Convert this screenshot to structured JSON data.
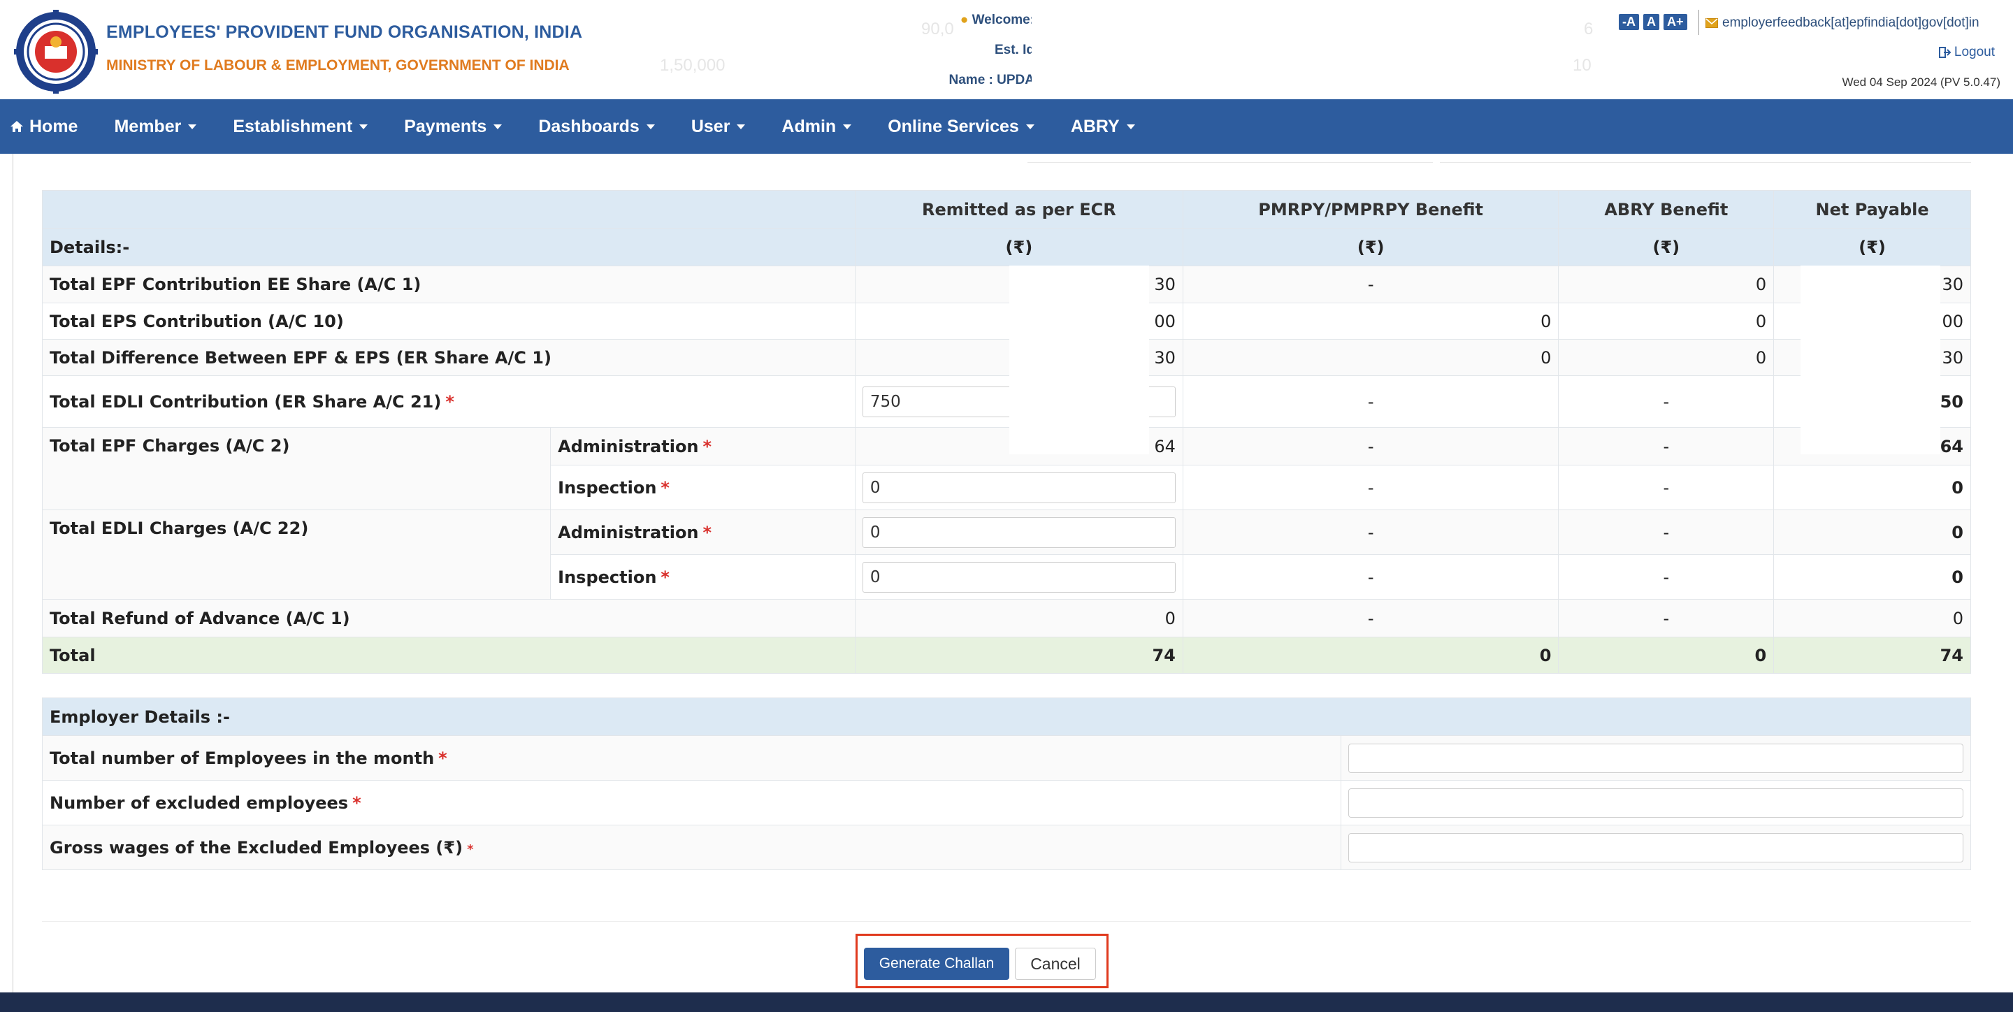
{
  "header": {
    "org_name": "EMPLOYEES' PROVIDENT FUND ORGANISATION, INDIA",
    "ministry": "MINISTRY OF LABOUR & EMPLOYMENT, GOVERNMENT OF INDIA",
    "ghost_values": [
      "90,0",
      "1,50,000",
      "6",
      "10"
    ],
    "welcome_label": "Welcome:",
    "est_id_label": "Est. Id",
    "name_label": "Name : UPDA",
    "font_buttons": [
      "-A",
      "A",
      "A+"
    ],
    "feedback_email": "employerfeedback[at]epfindia[dot]gov[dot]in",
    "logout_label": "Logout",
    "date_version": "Wed 04 Sep 2024 (PV 5.0.47)"
  },
  "nav": {
    "home": "Home",
    "items": [
      "Member",
      "Establishment",
      "Payments",
      "Dashboards",
      "User",
      "Admin",
      "Online Services",
      "ABRY"
    ]
  },
  "details": {
    "section_label": "Details:-",
    "columns": [
      "Remitted as per ECR",
      "PMRPY/PMPRPY Benefit",
      "ABRY Benefit",
      "Net Payable"
    ],
    "currency_symbol": "(₹)",
    "rows": {
      "epf_ee": {
        "label": "Total EPF Contribution EE Share (A/C 1)",
        "ecr": "30",
        "pmrpy": "-",
        "abry": "0",
        "net": "30"
      },
      "eps": {
        "label": "Total EPS Contribution (A/C 10)",
        "ecr": "00",
        "pmrpy": "0",
        "abry": "0",
        "net": "00"
      },
      "diff": {
        "label": "Total Difference Between EPF & EPS (ER Share A/C 1)",
        "ecr": "30",
        "pmrpy": "0",
        "abry": "0",
        "net": "30"
      },
      "edli": {
        "label": "Total EDLI Contribution (ER Share A/C 21)",
        "ecr_input": "750",
        "pmrpy": "-",
        "abry": "-",
        "net": "50"
      },
      "epf_admin": {
        "group_label": "Total EPF Charges (A/C 2)",
        "label": "Administration",
        "ecr": "64",
        "pmrpy": "-",
        "abry": "-",
        "net": "64"
      },
      "epf_insp": {
        "label": "Inspection",
        "ecr_input": "0",
        "pmrpy": "-",
        "abry": "-",
        "net": "0"
      },
      "edli_admin": {
        "group_label": "Total EDLI Charges (A/C 22)",
        "label": "Administration",
        "ecr_input": "0",
        "pmrpy": "-",
        "abry": "-",
        "net": "0"
      },
      "edli_insp": {
        "label": "Inspection",
        "ecr_input": "0",
        "pmrpy": "-",
        "abry": "-",
        "net": "0"
      },
      "refund": {
        "label": "Total Refund of Advance (A/C 1)",
        "ecr": "0",
        "pmrpy": "-",
        "abry": "-",
        "net": "0"
      },
      "total": {
        "label": "Total",
        "ecr": "74",
        "pmrpy": "0",
        "abry": "0",
        "net": "74"
      }
    },
    "required_mark": "*"
  },
  "employer": {
    "title": "Employer Details :-",
    "total_employees_label": "Total number of Employees in the month",
    "excluded_label": "Number of excluded employees",
    "gross_wages_label": "Gross wages of the Excluded Employees (₹)",
    "total_employees_value": "",
    "excluded_value": "",
    "gross_wages_value": ""
  },
  "actions": {
    "generate": "Generate Challan",
    "cancel": "Cancel"
  },
  "colors": {
    "primary": "#2d5c9e",
    "ministry": "#e07b1f",
    "required": "#d9302c",
    "highlight_box": "#e03a1e",
    "total_row": "#e7f2df",
    "header_row": "#dce9f4"
  }
}
